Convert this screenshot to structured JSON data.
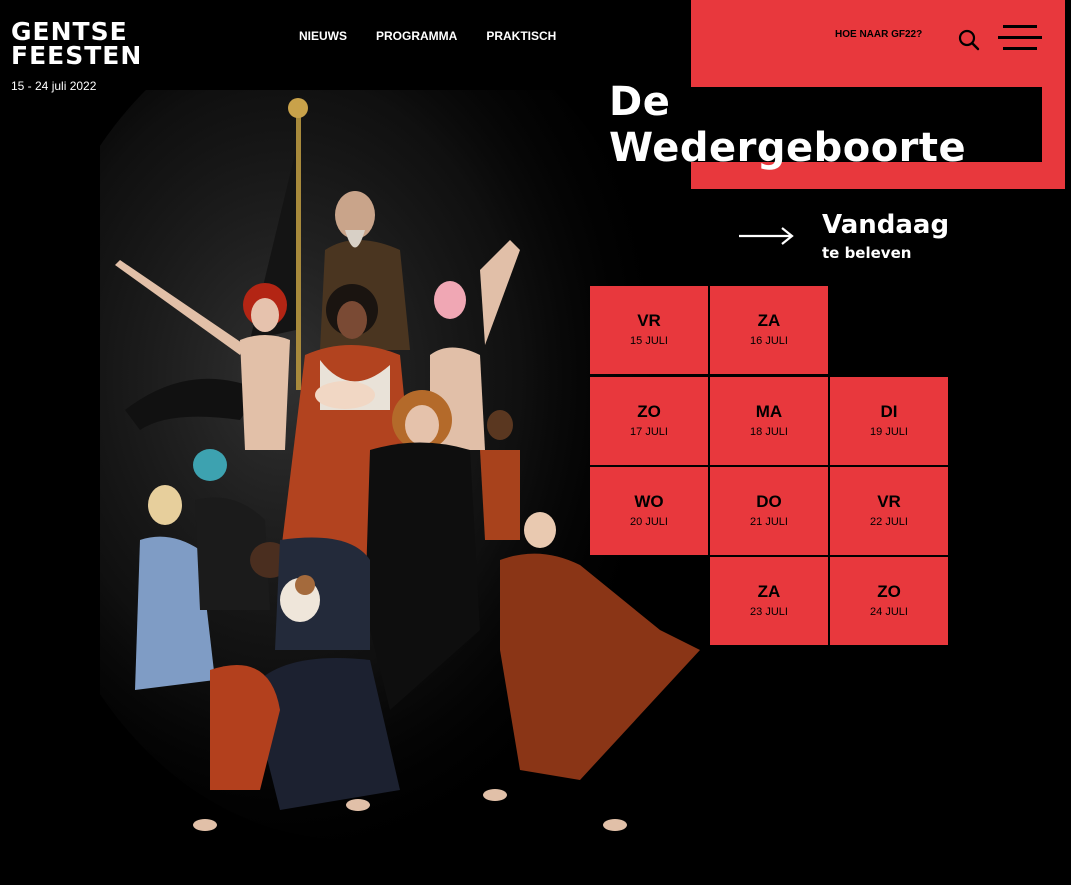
{
  "logo": {
    "line1": "GENTSE",
    "line2": "FEESTEN"
  },
  "festival_dates": "15 - 24 juli 2022",
  "nav": [
    "NIEUWS",
    "PROGRAMMA",
    "PRAKTISCH"
  ],
  "howto_link": "HOE NAAR GF22?",
  "headline": "De Wedergeboorte",
  "today": {
    "main": "Vandaag",
    "sub": "te beleven"
  },
  "days": [
    {
      "day": "VR",
      "date": "15 JULI"
    },
    {
      "day": "ZA",
      "date": "16 JULI"
    },
    {
      "day": "ZO",
      "date": "17 JULI"
    },
    {
      "day": "MA",
      "date": "18 JULI"
    },
    {
      "day": "DI",
      "date": "19 JULI"
    },
    {
      "day": "WO",
      "date": "20 JULI"
    },
    {
      "day": "DO",
      "date": "21 JULI"
    },
    {
      "day": "VR",
      "date": "22 JULI"
    },
    {
      "day": "ZA",
      "date": "23 JULI"
    },
    {
      "day": "ZO",
      "date": "24 JULI"
    }
  ],
  "icons": {
    "search": "search-icon",
    "menu": "hamburger-menu-icon",
    "arrow": "arrow-right-icon"
  },
  "colors": {
    "accent": "#e8383d",
    "background": "#000000",
    "text": "#ffffff"
  }
}
